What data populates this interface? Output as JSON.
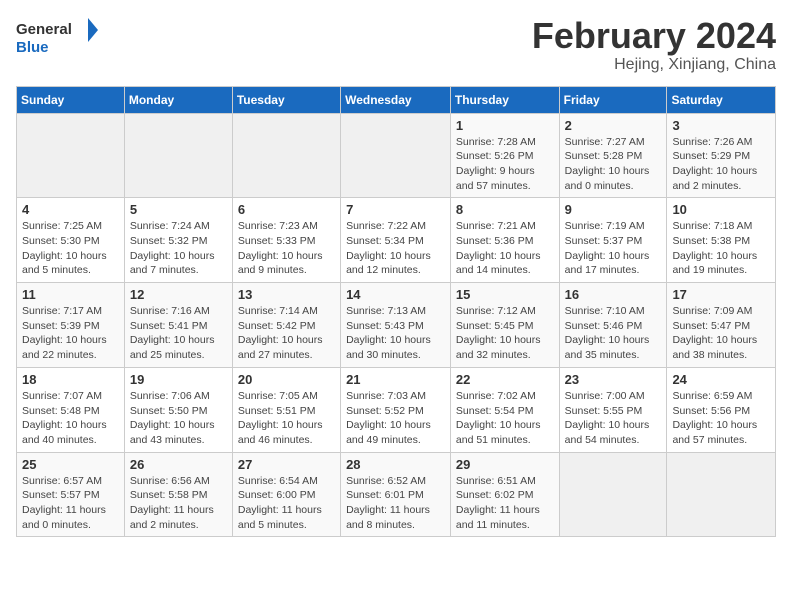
{
  "header": {
    "logo_line1": "General",
    "logo_line2": "Blue",
    "month_title": "February 2024",
    "subtitle": "Hejing, Xinjiang, China"
  },
  "columns": [
    "Sunday",
    "Monday",
    "Tuesday",
    "Wednesday",
    "Thursday",
    "Friday",
    "Saturday"
  ],
  "weeks": [
    [
      {
        "day": "",
        "info": ""
      },
      {
        "day": "",
        "info": ""
      },
      {
        "day": "",
        "info": ""
      },
      {
        "day": "",
        "info": ""
      },
      {
        "day": "1",
        "info": "Sunrise: 7:28 AM\nSunset: 5:26 PM\nDaylight: 9 hours and 57 minutes."
      },
      {
        "day": "2",
        "info": "Sunrise: 7:27 AM\nSunset: 5:28 PM\nDaylight: 10 hours and 0 minutes."
      },
      {
        "day": "3",
        "info": "Sunrise: 7:26 AM\nSunset: 5:29 PM\nDaylight: 10 hours and 2 minutes."
      }
    ],
    [
      {
        "day": "4",
        "info": "Sunrise: 7:25 AM\nSunset: 5:30 PM\nDaylight: 10 hours and 5 minutes."
      },
      {
        "day": "5",
        "info": "Sunrise: 7:24 AM\nSunset: 5:32 PM\nDaylight: 10 hours and 7 minutes."
      },
      {
        "day": "6",
        "info": "Sunrise: 7:23 AM\nSunset: 5:33 PM\nDaylight: 10 hours and 9 minutes."
      },
      {
        "day": "7",
        "info": "Sunrise: 7:22 AM\nSunset: 5:34 PM\nDaylight: 10 hours and 12 minutes."
      },
      {
        "day": "8",
        "info": "Sunrise: 7:21 AM\nSunset: 5:36 PM\nDaylight: 10 hours and 14 minutes."
      },
      {
        "day": "9",
        "info": "Sunrise: 7:19 AM\nSunset: 5:37 PM\nDaylight: 10 hours and 17 minutes."
      },
      {
        "day": "10",
        "info": "Sunrise: 7:18 AM\nSunset: 5:38 PM\nDaylight: 10 hours and 19 minutes."
      }
    ],
    [
      {
        "day": "11",
        "info": "Sunrise: 7:17 AM\nSunset: 5:39 PM\nDaylight: 10 hours and 22 minutes."
      },
      {
        "day": "12",
        "info": "Sunrise: 7:16 AM\nSunset: 5:41 PM\nDaylight: 10 hours and 25 minutes."
      },
      {
        "day": "13",
        "info": "Sunrise: 7:14 AM\nSunset: 5:42 PM\nDaylight: 10 hours and 27 minutes."
      },
      {
        "day": "14",
        "info": "Sunrise: 7:13 AM\nSunset: 5:43 PM\nDaylight: 10 hours and 30 minutes."
      },
      {
        "day": "15",
        "info": "Sunrise: 7:12 AM\nSunset: 5:45 PM\nDaylight: 10 hours and 32 minutes."
      },
      {
        "day": "16",
        "info": "Sunrise: 7:10 AM\nSunset: 5:46 PM\nDaylight: 10 hours and 35 minutes."
      },
      {
        "day": "17",
        "info": "Sunrise: 7:09 AM\nSunset: 5:47 PM\nDaylight: 10 hours and 38 minutes."
      }
    ],
    [
      {
        "day": "18",
        "info": "Sunrise: 7:07 AM\nSunset: 5:48 PM\nDaylight: 10 hours and 40 minutes."
      },
      {
        "day": "19",
        "info": "Sunrise: 7:06 AM\nSunset: 5:50 PM\nDaylight: 10 hours and 43 minutes."
      },
      {
        "day": "20",
        "info": "Sunrise: 7:05 AM\nSunset: 5:51 PM\nDaylight: 10 hours and 46 minutes."
      },
      {
        "day": "21",
        "info": "Sunrise: 7:03 AM\nSunset: 5:52 PM\nDaylight: 10 hours and 49 minutes."
      },
      {
        "day": "22",
        "info": "Sunrise: 7:02 AM\nSunset: 5:54 PM\nDaylight: 10 hours and 51 minutes."
      },
      {
        "day": "23",
        "info": "Sunrise: 7:00 AM\nSunset: 5:55 PM\nDaylight: 10 hours and 54 minutes."
      },
      {
        "day": "24",
        "info": "Sunrise: 6:59 AM\nSunset: 5:56 PM\nDaylight: 10 hours and 57 minutes."
      }
    ],
    [
      {
        "day": "25",
        "info": "Sunrise: 6:57 AM\nSunset: 5:57 PM\nDaylight: 11 hours and 0 minutes."
      },
      {
        "day": "26",
        "info": "Sunrise: 6:56 AM\nSunset: 5:58 PM\nDaylight: 11 hours and 2 minutes."
      },
      {
        "day": "27",
        "info": "Sunrise: 6:54 AM\nSunset: 6:00 PM\nDaylight: 11 hours and 5 minutes."
      },
      {
        "day": "28",
        "info": "Sunrise: 6:52 AM\nSunset: 6:01 PM\nDaylight: 11 hours and 8 minutes."
      },
      {
        "day": "29",
        "info": "Sunrise: 6:51 AM\nSunset: 6:02 PM\nDaylight: 11 hours and 11 minutes."
      },
      {
        "day": "",
        "info": ""
      },
      {
        "day": "",
        "info": ""
      }
    ]
  ]
}
